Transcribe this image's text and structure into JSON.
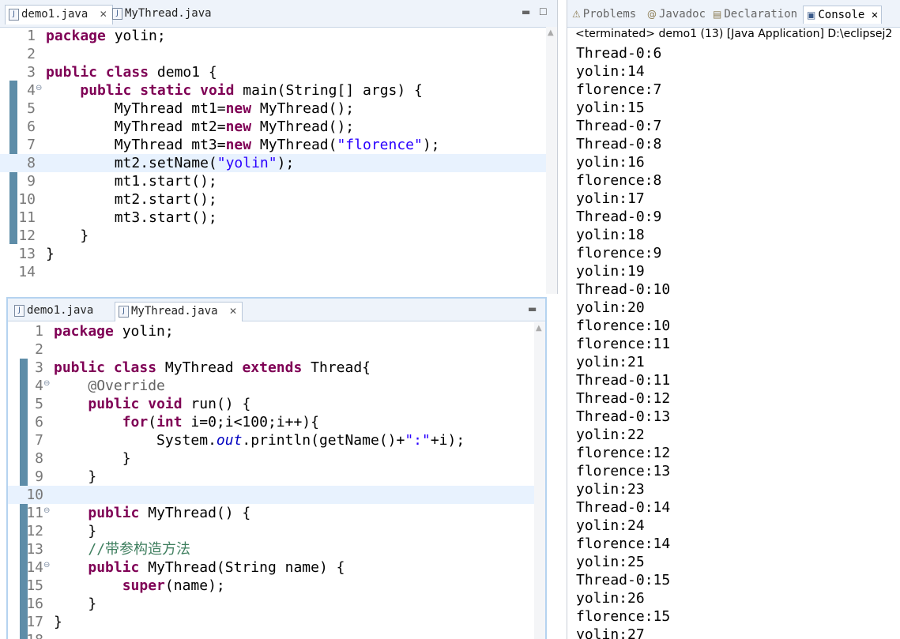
{
  "editor1": {
    "tabs": [
      {
        "label": "demo1.java",
        "active": true
      },
      {
        "label": "MyThread.java",
        "active": false
      }
    ],
    "lines": [
      {
        "num": "1",
        "html": "<span class='kw'>package</span> yolin;"
      },
      {
        "num": "2",
        "html": ""
      },
      {
        "num": "3",
        "html": "<span class='kw'>public</span> <span class='kw'>class</span> demo1 {"
      },
      {
        "num": "4",
        "html": "    <span class='kw'>public</span> <span class='kw'>static</span> <span class='kw'>void</span> main(String[] args) {",
        "fold": true
      },
      {
        "num": "5",
        "html": "        MyThread mt1=<span class='kw'>new</span> MyThread();"
      },
      {
        "num": "6",
        "html": "        MyThread mt2=<span class='kw'>new</span> MyThread();"
      },
      {
        "num": "7",
        "html": "        MyThread mt3=<span class='kw'>new</span> MyThread(<span class='str'>\"florence\"</span>);"
      },
      {
        "num": "8",
        "html": "        mt2.setName(<span class='str'>\"yolin\"</span>);",
        "hl": true
      },
      {
        "num": "9",
        "html": "        mt1.start();"
      },
      {
        "num": "10",
        "html": "        mt2.start();"
      },
      {
        "num": "11",
        "html": "        mt3.start();"
      },
      {
        "num": "12",
        "html": "    }"
      },
      {
        "num": "13",
        "html": "}"
      },
      {
        "num": "14",
        "html": ""
      }
    ]
  },
  "editor2": {
    "tabs": [
      {
        "label": "demo1.java",
        "active": false
      },
      {
        "label": "MyThread.java",
        "active": true
      }
    ],
    "lines": [
      {
        "num": "1",
        "html": "<span class='kw'>package</span> yolin;"
      },
      {
        "num": "2",
        "html": ""
      },
      {
        "num": "3",
        "html": "<span class='kw'>public</span> <span class='kw'>class</span> MyThread <span class='kw'>extends</span> Thread{"
      },
      {
        "num": "4",
        "html": "    <span class='ann'>@Override</span>",
        "fold": true
      },
      {
        "num": "5",
        "html": "    <span class='kw'>public</span> <span class='kw'>void</span> run() {"
      },
      {
        "num": "6",
        "html": "        <span class='kw'>for</span>(<span class='kw'>int</span> i=0;i&lt;100;i++){"
      },
      {
        "num": "7",
        "html": "            System.<span class='fld'>out</span>.println(getName()+<span class='str'>\":\"</span>+i);"
      },
      {
        "num": "8",
        "html": "        }"
      },
      {
        "num": "9",
        "html": "    }"
      },
      {
        "num": "10",
        "html": "",
        "hl": true
      },
      {
        "num": "11",
        "html": "    <span class='kw'>public</span> MyThread() {",
        "fold": true
      },
      {
        "num": "12",
        "html": "    }"
      },
      {
        "num": "13",
        "html": "    <span class='cmt'>//带参构造方法</span>"
      },
      {
        "num": "14",
        "html": "    <span class='kw'>public</span> MyThread(String name) {",
        "fold": true
      },
      {
        "num": "15",
        "html": "        <span class='kw'>super</span>(name);"
      },
      {
        "num": "16",
        "html": "    }"
      },
      {
        "num": "17",
        "html": "}"
      },
      {
        "num": "18",
        "html": ""
      }
    ]
  },
  "console": {
    "tabs": [
      {
        "label": "Problems",
        "icon": "problems-icon",
        "glyph": "⚠"
      },
      {
        "label": "Javadoc",
        "icon": "javadoc-icon",
        "glyph": "@"
      },
      {
        "label": "Declaration",
        "icon": "declaration-icon",
        "glyph": "▤"
      },
      {
        "label": "Console",
        "icon": "console-icon",
        "glyph": "▣",
        "active": true
      }
    ],
    "title": "<terminated> demo1 (13) [Java Application] D:\\eclipsej2",
    "output": [
      "Thread-0:6",
      "yolin:14",
      "florence:7",
      "yolin:15",
      "Thread-0:7",
      "Thread-0:8",
      "yolin:16",
      "florence:8",
      "yolin:17",
      "Thread-0:9",
      "yolin:18",
      "florence:9",
      "yolin:19",
      "Thread-0:10",
      "yolin:20",
      "florence:10",
      "florence:11",
      "yolin:21",
      "Thread-0:11",
      "Thread-0:12",
      "Thread-0:13",
      "yolin:22",
      "florence:12",
      "florence:13",
      "yolin:23",
      "Thread-0:14",
      "yolin:24",
      "florence:14",
      "yolin:25",
      "Thread-0:15",
      "yolin:26",
      "florence:15",
      "yolin:27"
    ]
  }
}
